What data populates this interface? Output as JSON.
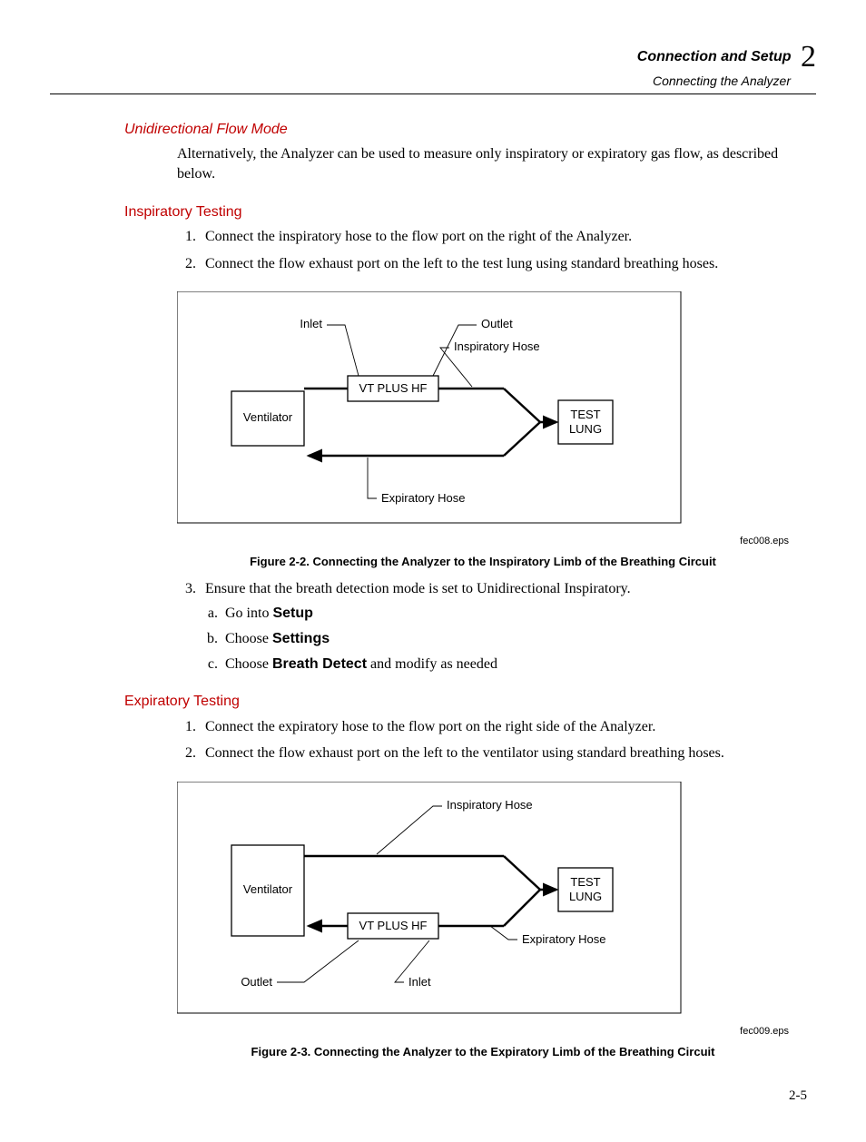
{
  "header": {
    "title": "Connection and Setup",
    "subtitle": "Connecting the Analyzer",
    "chapter": "2"
  },
  "sec1": {
    "heading": "Unidirectional Flow Mode",
    "para": "Alternatively, the Analyzer can be used to measure only inspiratory or expiratory gas flow, as described below."
  },
  "insp": {
    "heading": "Inspiratory Testing",
    "step1": "Connect the inspiratory hose to the flow port on the right of the Analyzer.",
    "step2": "Connect the flow exhaust port on the left to the test lung using standard breathing hoses.",
    "step3": "Ensure that the breath detection mode is set to Unidirectional Inspiratory.",
    "sub_a_1": "Go into ",
    "sub_a_2": "Setup",
    "sub_b_1": "Choose ",
    "sub_b_2": "Settings",
    "sub_c_1": "Choose ",
    "sub_c_2": "Breath Detect",
    "sub_c_3": " and modify as needed"
  },
  "fig1": {
    "labels": {
      "inlet": "Inlet",
      "outlet": "Outlet",
      "insp_hose": "Inspiratory Hose",
      "ventilator": "Ventilator",
      "device": "VT PLUS HF",
      "test": "TEST",
      "lung": "LUNG",
      "exp_hose": "Expiratory Hose"
    },
    "file": "fec008.eps",
    "caption": "Figure 2-2. Connecting the Analyzer to the Inspiratory Limb of the Breathing Circuit"
  },
  "exp": {
    "heading": "Expiratory Testing",
    "step1": "Connect the expiratory hose to the flow port on the right side of the Analyzer.",
    "step2": "Connect the flow exhaust port on the left to the ventilator using standard breathing hoses."
  },
  "fig2": {
    "labels": {
      "insp_hose": "Inspiratory Hose",
      "ventilator": "Ventilator",
      "device": "VT PLUS HF",
      "test": "TEST",
      "lung": "LUNG",
      "exp_hose": "Expiratory Hose",
      "outlet": "Outlet",
      "inlet": "Inlet"
    },
    "file": "fec009.eps",
    "caption": "Figure 2-3. Connecting the Analyzer to the Expiratory Limb of the Breathing Circuit"
  },
  "page": "2-5"
}
